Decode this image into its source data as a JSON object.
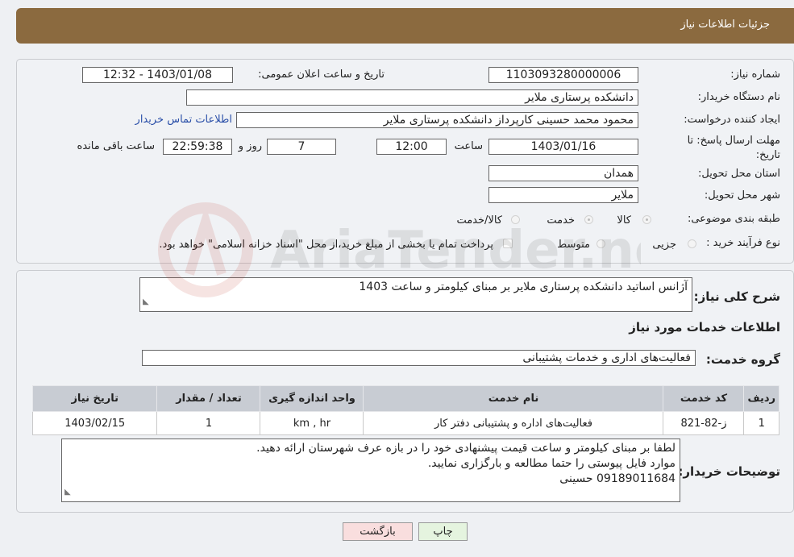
{
  "header": {
    "title": "جزئیات اطلاعات نیاز"
  },
  "form": {
    "need_number_label": "شماره نیاز:",
    "need_number": "1103093280000006",
    "announce_label": "تاریخ و ساعت اعلان عمومی:",
    "announce_value": "1403/01/08 - 12:32",
    "buyer_org_label": "نام دستگاه خریدار:",
    "buyer_org": "دانشکده پرستاری ملایر",
    "creator_label": "ایجاد کننده درخواست:",
    "creator": "محمود محمد حسینی کارپرداز دانشکده پرستاری ملایر",
    "buyer_contact_link": "اطلاعات تماس خریدار",
    "deadline_label": "مهلت ارسال پاسخ: تا تاریخ:",
    "deadline_date": "1403/01/16",
    "time_label": "ساعت",
    "deadline_time": "12:00",
    "days": "7",
    "days_label": "روز و",
    "remaining_time": "22:59:38",
    "remaining_label": "ساعت باقی مانده",
    "province_label": "استان محل تحویل:",
    "province": "همدان",
    "city_label": "شهر محل تحویل:",
    "city": "ملایر",
    "category_label": "طبقه بندی موضوعی:",
    "category_options": [
      "کالا",
      "خدمت",
      "کالا/خدمت"
    ],
    "process_label": "نوع فرآیند خرید :",
    "process_options": [
      "جزیی",
      "متوسط"
    ],
    "payment_note": "پرداخت تمام یا بخشی از مبلغ خرید،از محل \"اسناد خزانه اسلامی\" خواهد بود."
  },
  "details": {
    "summary_label": "شرح کلی نیاز:",
    "summary": "آژانس اساتید دانشکده پرستاری ملایر بر مبنای کیلومتر و ساعت 1403",
    "services_title": "اطلاعات خدمات مورد نیاز",
    "service_group_label": "گروه خدمت:",
    "service_group": "فعالیت‌های اداری و خدمات پشتیبانی",
    "table": {
      "headers": [
        "ردیف",
        "کد خدمت",
        "نام خدمت",
        "واحد اندازه گیری",
        "تعداد / مقدار",
        "تاریخ نیاز"
      ],
      "rows": [
        [
          "1",
          "ز-82-821",
          "فعالیت‌های اداره و پشتیبانی دفتر کار",
          "km , hr",
          "1",
          "1403/02/15"
        ]
      ]
    },
    "buyer_notes_label": "توضیحات خریدار:",
    "buyer_notes": [
      "لطفا بر مبنای کیلومتر و ساعت قیمت پیشنهادی خود را در بازه عرف شهرستان ارائه دهید.",
      "موارد فایل پیوستی را حتما مطالعه و بارگزاری نمایید.",
      "09189011684 حسینی"
    ]
  },
  "buttons": {
    "print": "چاپ",
    "back": "بازگشت"
  },
  "watermark": {
    "text": "AriaTender.neT"
  },
  "colors": {
    "header": "#8b6a3f",
    "link": "#2a4fa8",
    "back_button": "#f9dede",
    "print_button": "#e5f4df"
  }
}
